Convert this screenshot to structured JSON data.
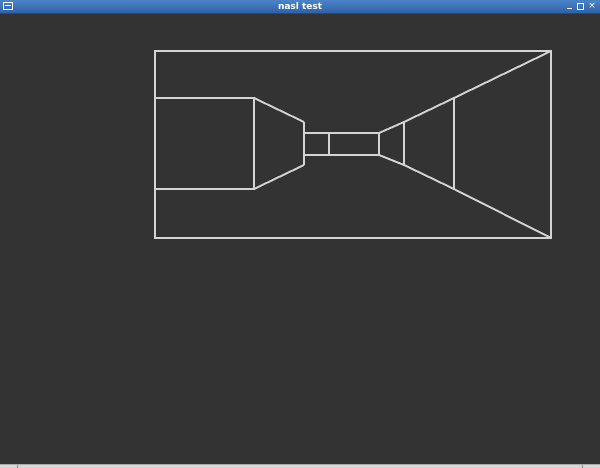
{
  "window": {
    "title": "nasl test"
  },
  "controls": {
    "menu": "window-menu-icon",
    "minimize": "minimize-icon",
    "maximize": "maximize-icon",
    "close": "close-icon",
    "close_glyph": "×"
  },
  "colors": {
    "background": "#333333",
    "lines": "#d4d4d4",
    "titlebar": "#3a6fb5"
  }
}
